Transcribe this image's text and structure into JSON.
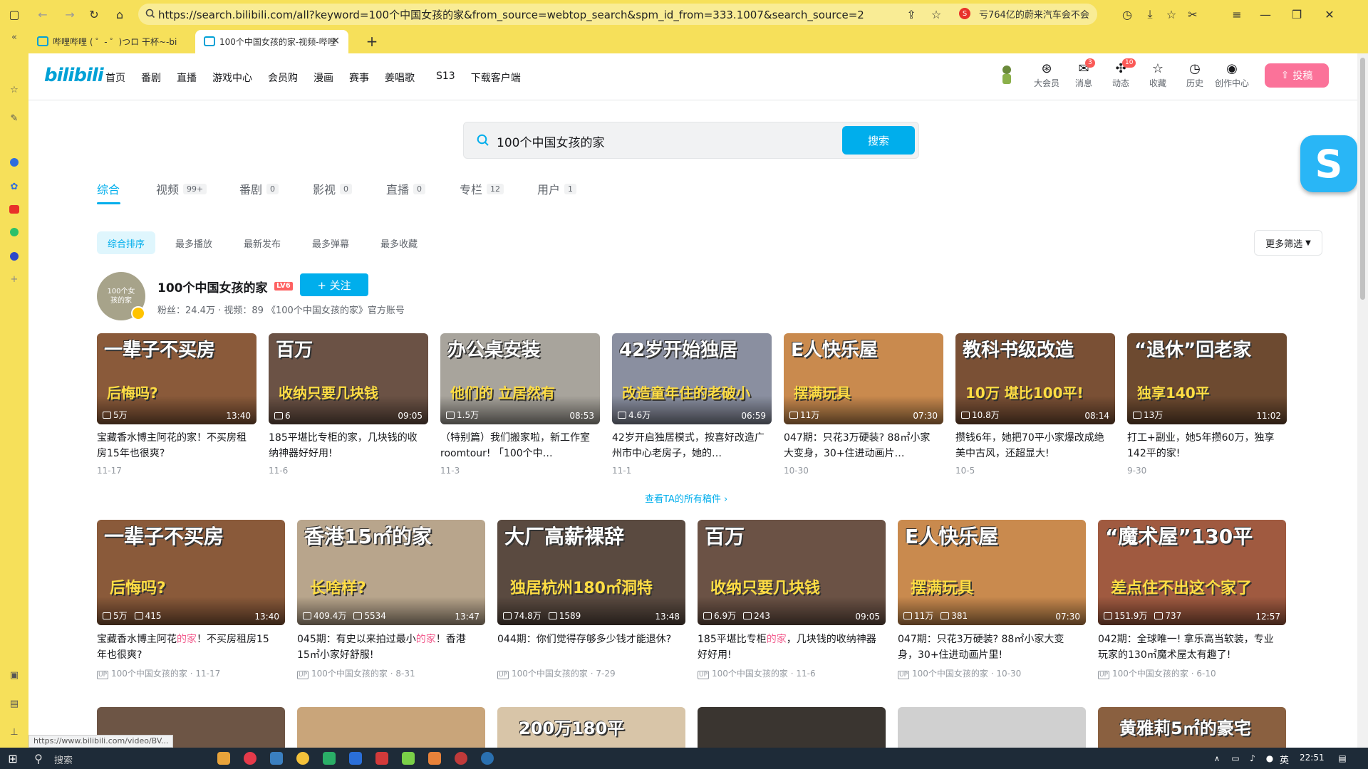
{
  "browser": {
    "url": "https://search.bilibili.com/all?keyword=100个中国女孩的家&from_source=webtop_search&spm_id_from=333.1007&search_source=2",
    "news_ticker": "亏764亿的蔚来汽车会不会",
    "tabs": [
      {
        "label": "哔哩哔哩 ( ゜- ゜)つロ 干杯~-bilib"
      },
      {
        "label": "100个中国女孩的家-视频-哔哩"
      }
    ],
    "status_url": "https://www.bilibili.com/video/BV..."
  },
  "header": {
    "logo": "bilibili",
    "nav": [
      "首页",
      "番剧",
      "直播",
      "游戏中心",
      "会员购",
      "漫画",
      "赛事",
      "姜唱歌",
      "S13",
      "下载客户端"
    ],
    "icons": [
      {
        "label": "大会员",
        "icon": "vip-icon",
        "badge": ""
      },
      {
        "label": "消息",
        "icon": "message-icon",
        "badge": "3"
      },
      {
        "label": "动态",
        "icon": "dynamic-icon",
        "badge": "10"
      },
      {
        "label": "收藏",
        "icon": "star-icon",
        "badge": ""
      },
      {
        "label": "历史",
        "icon": "clock-icon",
        "badge": ""
      },
      {
        "label": "创作中心",
        "icon": "bulb-icon",
        "badge": ""
      }
    ],
    "upload_label": "投稿"
  },
  "search": {
    "query": "100个中国女孩的家",
    "button": "搜索"
  },
  "type_tabs": [
    {
      "label": "综合",
      "count": ""
    },
    {
      "label": "视频",
      "count": "99+"
    },
    {
      "label": "番剧",
      "count": "0"
    },
    {
      "label": "影视",
      "count": "0"
    },
    {
      "label": "直播",
      "count": "0"
    },
    {
      "label": "专栏",
      "count": "12"
    },
    {
      "label": "用户",
      "count": "1"
    }
  ],
  "sorts": [
    "综合排序",
    "最多播放",
    "最新发布",
    "最多弹幕",
    "最多收藏"
  ],
  "more_filter": "更多筛选",
  "up": {
    "name": "100个中国女孩的家",
    "level": "LV6",
    "follow": "+ 关注",
    "meta": "粉丝：24.4万 · 视频：89  《100个中国女孩的家》官方账号",
    "avatar_text": "100个女孩的家"
  },
  "up_videos": [
    {
      "thumb_text": "一辈子不买房",
      "thumb_text2": "后悔吗?",
      "views": "5万",
      "duration": "13:40",
      "title": "宝藏香水博主阿花的家！不买房租房15年也很爽?",
      "date": "11-17",
      "color": "#8a5a3a"
    },
    {
      "thumb_text": "百万",
      "thumb_text2": "收纳只要几块钱",
      "views": "6",
      "duration": "09:05",
      "title": "185平堪比专柜的家，几块钱的收纳神器好好用!",
      "date": "11-6",
      "color": "#6b5245"
    },
    {
      "thumb_text": "办公桌安装",
      "thumb_text2": "他们的 立居然有",
      "views": "1.5万",
      "duration": "08:53",
      "title": "（特别篇）我们搬家啦，新工作室roomtour! 「100个中…",
      "date": "11-3",
      "color": "#a8a49c"
    },
    {
      "thumb_text": "42岁开始独居",
      "thumb_text2": "改造童年住的老破小",
      "views": "4.6万",
      "duration": "06:59",
      "title": "42岁开启独居模式，按喜好改造广州市中心老房子，她的…",
      "date": "11-1",
      "color": "#8a8fa0"
    },
    {
      "thumb_text": "E人快乐屋",
      "thumb_text2": "摆满玩具",
      "views": "11万",
      "duration": "07:30",
      "title": "047期：只花3万硬装? 88㎡小家大变身，30+住进动画片…",
      "date": "10-30",
      "color": "#c98a4e"
    },
    {
      "thumb_text": "教科书级改造",
      "thumb_text2": "10万 堪比100平!",
      "views": "10.8万",
      "duration": "08:14",
      "title": "攒钱6年，她把70平小家爆改成绝美中古风，还超显大!",
      "date": "10-5",
      "color": "#7a5035"
    },
    {
      "thumb_text": "“退休”回老家",
      "thumb_text2": "独享140平",
      "views": "13万",
      "duration": "11:02",
      "title": "打工+副业，她5年攒60万，独享142平的家!",
      "date": "9-30",
      "color": "#6d4a30"
    }
  ],
  "see_all": "查看TA的所有稿件",
  "videos": [
    {
      "thumb_text": "一辈子不买房",
      "thumb_text2": "后悔吗?",
      "views": "5万",
      "danmaku": "415",
      "duration": "13:40",
      "title_a": "宝藏香水博主阿花",
      "title_hl": "的家",
      "title_b": "！不买房租房15年也很爽?",
      "author": "100个中国女孩的家",
      "date": "11-17",
      "color": "#8a5a3a"
    },
    {
      "thumb_text": "香港15㎡的家",
      "thumb_text2": "长啥样?",
      "views": "409.4万",
      "danmaku": "5534",
      "duration": "13:47",
      "title_a": "045期：有史以来拍过最小",
      "title_hl": "的家",
      "title_b": "！香港15㎡小家好舒服!",
      "author": "100个中国女孩的家",
      "date": "8-31",
      "color": "#b8a58c"
    },
    {
      "thumb_text": "大厂高薪裸辞",
      "thumb_text2": "独居杭州180㎡洞特",
      "views": "74.8万",
      "danmaku": "1589",
      "duration": "13:48",
      "title_a": "044期：你们觉得存够多少钱才能退休?",
      "title_hl": "",
      "title_b": "",
      "author": "100个中国女孩的家",
      "date": "7-29",
      "color": "#5a4a40"
    },
    {
      "thumb_text": "百万",
      "thumb_text2": "收纳只要几块钱",
      "views": "6.9万",
      "danmaku": "243",
      "duration": "09:05",
      "title_a": "185平堪比专柜",
      "title_hl": "的家",
      "title_b": "，几块钱的收纳神器好好用!",
      "author": "100个中国女孩的家",
      "date": "11-6",
      "color": "#6b5245"
    },
    {
      "thumb_text": "E人快乐屋",
      "thumb_text2": "摆满玩具",
      "views": "11万",
      "danmaku": "381",
      "duration": "07:30",
      "title_a": "047期：只花3万硬装? 88㎡小家大变身，30+住进动画片里!",
      "title_hl": "",
      "title_b": "",
      "author": "100个中国女孩的家",
      "date": "10-30",
      "color": "#c98a4e"
    },
    {
      "thumb_text": "“魔术屋”130平",
      "thumb_text2": "差点住不出这个家了",
      "views": "151.9万",
      "danmaku": "737",
      "duration": "12:57",
      "title_a": "042期：全球唯一! 拿乐高当软装，专业玩家的130㎡魔术屋太有趣了!",
      "title_hl": "",
      "title_b": "",
      "author": "100个中国女孩的家",
      "date": "6-10",
      "color": "#a05a40"
    }
  ],
  "next_row": [
    {
      "thumb_text": "",
      "color": "#6d5545"
    },
    {
      "thumb_text": "",
      "color": "#c9a57a"
    },
    {
      "thumb_text": "200万180平",
      "color": "#d8c5a8"
    },
    {
      "thumb_text": "",
      "color": "#3a3530"
    },
    {
      "thumb_text": "",
      "color": "#d0d0d0"
    },
    {
      "thumb_text": "黄雅莉5㎡的豪宅",
      "color": "#8a6040"
    }
  ],
  "taskbar": {
    "search": "搜索",
    "time": "22:51",
    "ime": "英"
  }
}
